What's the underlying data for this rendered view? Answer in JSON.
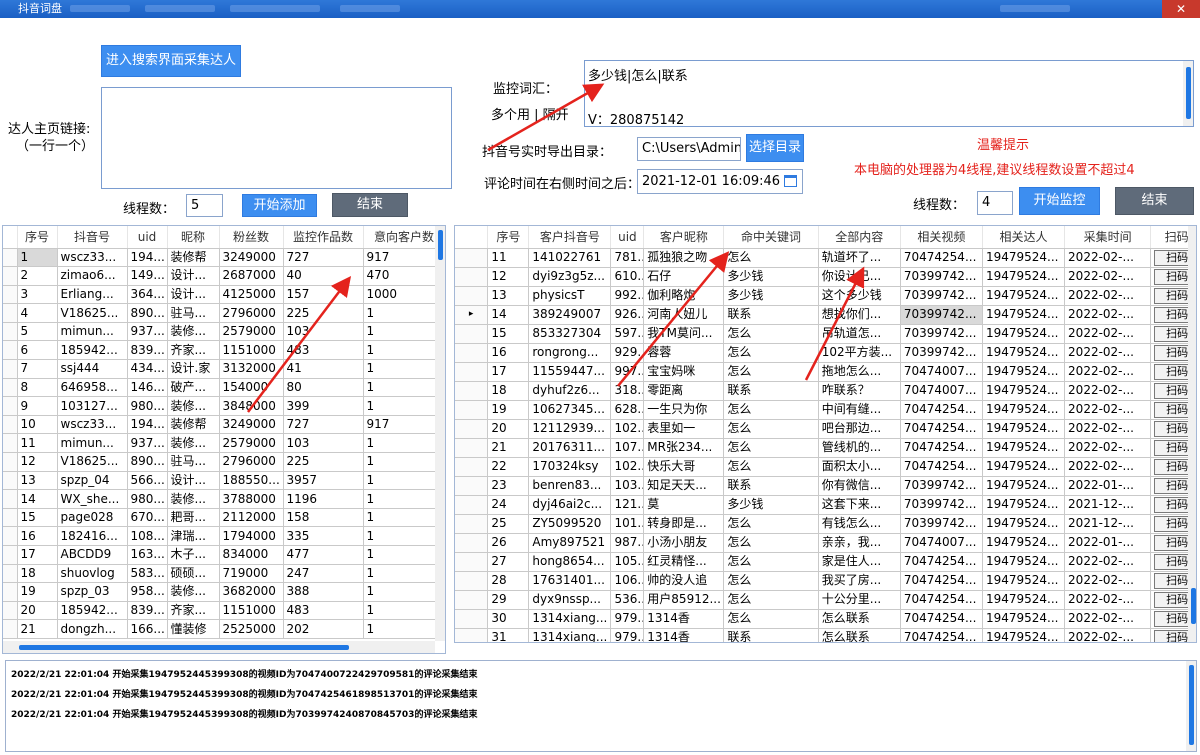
{
  "window": {
    "title": "抖音词盘",
    "close_glyph": "✕"
  },
  "left_panel": {
    "search_button": "进入搜索界面采集达人",
    "homepage_label": "达人主页链接:",
    "homepage_hint": "（一行一个）",
    "thread_label": "线程数：",
    "thread_value": "5",
    "add_button": "开始添加",
    "end_button": "结束"
  },
  "monitor_panel": {
    "keywords_label": "监控词汇：",
    "keywords_hint": "多个用 | 隔开",
    "keywords_value_line1": "多少钱|怎么|联系",
    "keywords_value_line2": "V：280875142",
    "export_label": "抖音号实时导出目录：",
    "export_value": "C:\\Users\\Admin",
    "choose_dir_button": "选择目录",
    "time_label": "评论时间在右侧时间之后：",
    "time_value": "2021-12-01 16:09:46",
    "calendar_icon": "calendar-icon",
    "notice_title": "温馨提示",
    "notice_text": "本电脑的处理器为4线程,建议线程数设置不超过4",
    "thread_label": "线程数：",
    "thread_value": "4",
    "start_button": "开始监控",
    "end_button": "结束"
  },
  "left_table": {
    "columns": [
      "序号",
      "抖音号",
      "uid",
      "昵称",
      "粉丝数",
      "监控作品数",
      "意向客户数"
    ],
    "rows": [
      [
        "1",
        "wscz33...",
        "194...",
        "装修帮",
        "3249000",
        "727",
        "917"
      ],
      [
        "2",
        "zimao6...",
        "149...",
        "设计...",
        "2687000",
        "40",
        "470"
      ],
      [
        "3",
        "Erliang...",
        "364...",
        "设计...",
        "4125000",
        "157",
        "1000"
      ],
      [
        "4",
        "V18625...",
        "890...",
        "驻马...",
        "2796000",
        "225",
        "1"
      ],
      [
        "5",
        "mimun...",
        "937...",
        "装修...",
        "2579000",
        "103",
        "1"
      ],
      [
        "6",
        "185942...",
        "839...",
        "齐家...",
        "1151000",
        "483",
        "1"
      ],
      [
        "7",
        "ssj444",
        "434...",
        "设计.家",
        "3132000",
        "41",
        "1"
      ],
      [
        "8",
        "646958...",
        "146...",
        "破产...",
        "154000",
        "80",
        "1"
      ],
      [
        "9",
        "103127...",
        "980...",
        "装修...",
        "3848000",
        "399",
        "1"
      ],
      [
        "10",
        "wscz33...",
        "194...",
        "装修帮",
        "3249000",
        "727",
        "917"
      ],
      [
        "11",
        "mimun...",
        "937...",
        "装修...",
        "2579000",
        "103",
        "1"
      ],
      [
        "12",
        "V18625...",
        "890...",
        "驻马...",
        "2796000",
        "225",
        "1"
      ],
      [
        "13",
        "spzp_04",
        "566...",
        "设计...",
        "188550...",
        "3957",
        "1"
      ],
      [
        "14",
        "WX_she...",
        "980...",
        "装修...",
        "3788000",
        "1196",
        "1"
      ],
      [
        "15",
        "page028",
        "670...",
        "耙哥...",
        "2112000",
        "158",
        "1"
      ],
      [
        "16",
        "182416...",
        "108...",
        "津瑞...",
        "1794000",
        "335",
        "1"
      ],
      [
        "17",
        "ABCDD9",
        "163...",
        "木子...",
        "834000",
        "477",
        "1"
      ],
      [
        "18",
        "shuovlog",
        "583...",
        "硕硕...",
        "719000",
        "247",
        "1"
      ],
      [
        "19",
        "spzp_03",
        "958...",
        "装修...",
        "3682000",
        "388",
        "1"
      ],
      [
        "20",
        "185942...",
        "839...",
        "齐家...",
        "1151000",
        "483",
        "1"
      ],
      [
        "21",
        "dongzh...",
        "166...",
        "懂装修",
        "2525000",
        "202",
        "1"
      ]
    ]
  },
  "right_table": {
    "columns": [
      "序号",
      "客户抖音号",
      "uid",
      "客户昵称",
      "命中关键词",
      "全部内容",
      "相关视频",
      "相关达人",
      "采集时间",
      "扫码私"
    ],
    "current_row_marker": "▸",
    "qr_label": "扫码私",
    "rows": [
      [
        "11",
        "141022761",
        "781...",
        "孤独狼之吻",
        "怎么",
        "轨道坏了...",
        "70474254...",
        "19479524...",
        "2022-02-..."
      ],
      [
        "12",
        "dyi9z3g5z...",
        "610...",
        "石仔",
        "多少钱",
        "你设计已...",
        "70399742...",
        "19479524...",
        "2022-02-..."
      ],
      [
        "13",
        "physicsT",
        "992...",
        "伽利略炮",
        "多少钱",
        "这个多少钱",
        "70399742...",
        "19479524...",
        "2022-02-..."
      ],
      [
        "14",
        "389249007",
        "926...",
        "河南人妞儿",
        "联系",
        "想找你们...",
        "70399742...",
        "19479524...",
        "2022-02-..."
      ],
      [
        "15",
        "853327304",
        "597...",
        "我TM莫问...",
        "怎么",
        "吊轨道怎...",
        "70399742...",
        "19479524...",
        "2022-02-..."
      ],
      [
        "16",
        "rongrong...",
        "929...",
        "蓉蓉",
        "怎么",
        "102平方装...",
        "70399742...",
        "19479524...",
        "2022-02-..."
      ],
      [
        "17",
        "11559447...",
        "997...",
        "宝宝妈咪",
        "怎么",
        "拖地怎么...",
        "70474007...",
        "19479524...",
        "2022-02-..."
      ],
      [
        "18",
        "dyhuf2z6...",
        "318...",
        "零距离",
        "联系",
        "咋联系？",
        "70474007...",
        "19479524...",
        "2022-02-..."
      ],
      [
        "19",
        "10627345...",
        "628...",
        "一生只为你",
        "怎么",
        "中间有缝...",
        "70474254...",
        "19479524...",
        "2022-02-..."
      ],
      [
        "20",
        "12112939...",
        "102...",
        "表里如一",
        "怎么",
        "吧台那边...",
        "70474254...",
        "19479524...",
        "2022-02-..."
      ],
      [
        "21",
        "20176311...",
        "107...",
        "MR张234...",
        "怎么",
        "管线机的...",
        "70474254...",
        "19479524...",
        "2022-02-..."
      ],
      [
        "22",
        "170324ksy",
        "102...",
        "快乐大哥",
        "怎么",
        "面积太小...",
        "70474254...",
        "19479524...",
        "2022-02-..."
      ],
      [
        "23",
        "benren83...",
        "103...",
        "知足天天...",
        "联系",
        "你有微信...",
        "70399742...",
        "19479524...",
        "2022-01-..."
      ],
      [
        "24",
        "dyj46ai2c...",
        "121...",
        "莫",
        "多少钱",
        "这套下来...",
        "70399742...",
        "19479524...",
        "2021-12-..."
      ],
      [
        "25",
        "ZY5099520",
        "101...",
        "转身即是...",
        "怎么",
        "有钱怎么...",
        "70399742...",
        "19479524...",
        "2021-12-..."
      ],
      [
        "26",
        "Amy897521",
        "987...",
        "小汤小朋友",
        "怎么",
        "亲亲，我...",
        "70474007...",
        "19479524...",
        "2022-01-..."
      ],
      [
        "27",
        "hong8654...",
        "105...",
        "红灵精怪...",
        "怎么",
        "家是住人...",
        "70474254...",
        "19479524...",
        "2022-02-..."
      ],
      [
        "28",
        "17631401...",
        "106...",
        "帅的没人追",
        "怎么",
        "我买了房...",
        "70474254...",
        "19479524...",
        "2022-02-..."
      ],
      [
        "29",
        "dyx9nssp...",
        "536...",
        "用户85912...",
        "怎么",
        "十公分里...",
        "70474254...",
        "19479524...",
        "2022-02-..."
      ],
      [
        "30",
        "1314xiang...",
        "979...",
        "1314香",
        "怎么",
        "怎么联系",
        "70474254...",
        "19479524...",
        "2022-02-..."
      ],
      [
        "31",
        "1314xiang...",
        "979...",
        "1314香",
        "联系",
        "怎么联系",
        "70474254...",
        "19479524...",
        "2022-02-..."
      ]
    ]
  },
  "log": [
    "2022/2/21 22:01:04 开始采集1947952445399308的视频ID为7047400722429709581的评论采集结束",
    "2022/2/21 22:01:04 开始采集1947952445399308的视频ID为7047425461898513701的评论采集结束",
    "2022/2/21 22:01:04 开始采集1947952445399308的视频ID为7039974240870845703的评论采集结束"
  ],
  "colors": {
    "accent": "#3d8ef0",
    "titlebar": "#1a5fc4",
    "notice": "#e4231d",
    "arrow": "#e4231d"
  }
}
